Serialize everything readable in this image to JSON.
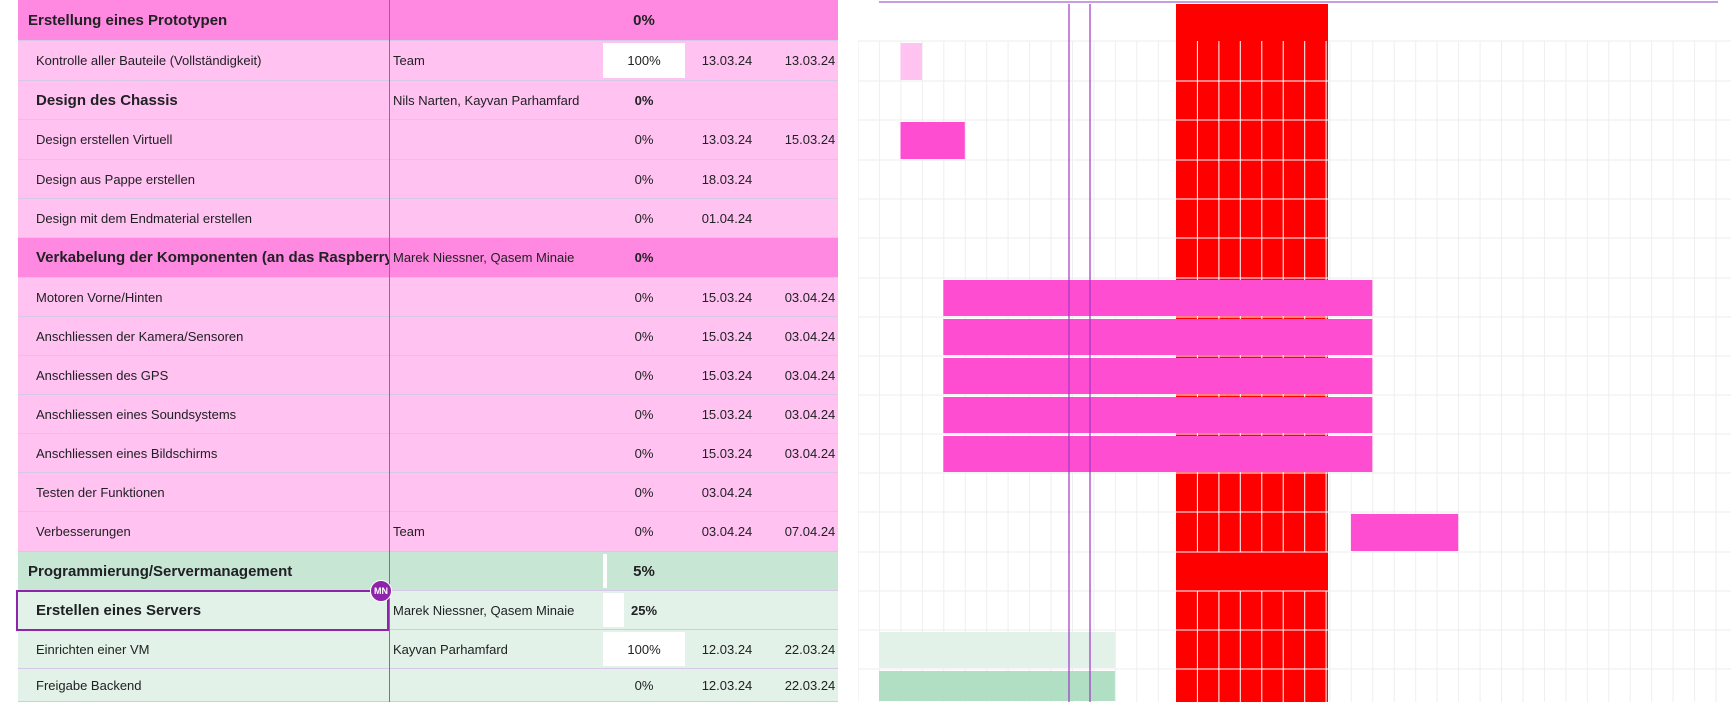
{
  "colors": {
    "section_pink": "#ff88e0",
    "row_pink": "#ffc2f1",
    "section_green": "#c8e6d4",
    "row_green": "#e2f2e8",
    "gantt_bar": "#ff4dd2",
    "gantt_bar_light": "#ffc2f1",
    "today_block": "#ff0000",
    "green_bar_light": "#e2f2e8",
    "green_bar": "#b0dfc4",
    "selection": "#8e24aa"
  },
  "rows": [
    {
      "type": "section",
      "group": "pink",
      "task": "Erstellung eines Prototypen",
      "team": "",
      "progress": "0%",
      "progress_value": 0,
      "start": "",
      "end": ""
    },
    {
      "type": "task",
      "group": "pink",
      "task": "Kontrolle aller Bauteile (Vollständigkeit)",
      "team": "Team",
      "progress": "100%",
      "progress_value": 1,
      "start": "13.03.24",
      "end": "13.03.24"
    },
    {
      "type": "subsection",
      "group": "pink",
      "task": "Design des Chassis",
      "team": "Nils Narten, Kayvan Parhamfard",
      "progress": "0%",
      "progress_value": 0,
      "start": "",
      "end": ""
    },
    {
      "type": "task",
      "group": "pink",
      "task": "Design erstellen Virtuell",
      "team": "",
      "progress": "0%",
      "progress_value": 0,
      "start": "13.03.24",
      "end": "15.03.24"
    },
    {
      "type": "task",
      "group": "pink",
      "task": "Design aus Pappe erstellen",
      "team": "",
      "progress": "0%",
      "progress_value": 0,
      "start": "18.03.24",
      "end": ""
    },
    {
      "type": "task",
      "group": "pink",
      "task": "Design mit dem Endmaterial erstellen",
      "team": "",
      "progress": "0%",
      "progress_value": 0,
      "start": "01.04.24",
      "end": ""
    },
    {
      "type": "subsection-strong",
      "group": "pink",
      "task": "Verkabelung der Komponenten (an das Raspberry",
      "team": "Marek Niessner, Qasem Minaie",
      "progress": "0%",
      "progress_value": 0,
      "start": "",
      "end": ""
    },
    {
      "type": "task",
      "group": "pink",
      "task": "Motoren Vorne/Hinten",
      "team": "",
      "progress": "0%",
      "progress_value": 0,
      "start": "15.03.24",
      "end": "03.04.24"
    },
    {
      "type": "task",
      "group": "pink",
      "task": "Anschliessen der Kamera/Sensoren",
      "team": "",
      "progress": "0%",
      "progress_value": 0,
      "start": "15.03.24",
      "end": "03.04.24"
    },
    {
      "type": "task",
      "group": "pink",
      "task": "Anschliessen des GPS",
      "team": "",
      "progress": "0%",
      "progress_value": 0,
      "start": "15.03.24",
      "end": "03.04.24"
    },
    {
      "type": "task",
      "group": "pink",
      "task": "Anschliessen eines Soundsystems",
      "team": "",
      "progress": "0%",
      "progress_value": 0,
      "start": "15.03.24",
      "end": "03.04.24"
    },
    {
      "type": "task",
      "group": "pink",
      "task": "Anschliessen eines Bildschirms",
      "team": "",
      "progress": "0%",
      "progress_value": 0,
      "start": "15.03.24",
      "end": "03.04.24"
    },
    {
      "type": "task",
      "group": "pink",
      "task": "Testen der Funktionen",
      "team": "",
      "progress": "0%",
      "progress_value": 0,
      "start": "03.04.24",
      "end": ""
    },
    {
      "type": "task",
      "group": "pink",
      "task": "Verbesserungen",
      "team": "Team",
      "progress": "0%",
      "progress_value": 0,
      "start": "03.04.24",
      "end": "07.04.24"
    },
    {
      "type": "section",
      "group": "green",
      "task": "Programmierung/Servermanagement",
      "team": "",
      "progress": "5%",
      "progress_value": 0.05,
      "start": "",
      "end": ""
    },
    {
      "type": "subsection",
      "group": "green",
      "task": "Erstellen eines Servers",
      "team": "Marek Niessner, Qasem Minaie",
      "progress": "25%",
      "progress_value": 0.25,
      "start": "",
      "end": ""
    },
    {
      "type": "task",
      "group": "green",
      "task": "Einrichten einer VM",
      "team": "Kayvan Parhamfard",
      "progress": "100%",
      "progress_value": 1,
      "start": "12.03.24",
      "end": "22.03.24"
    },
    {
      "type": "task",
      "group": "green",
      "task": "Freigabe Backend",
      "team": "",
      "progress": "0%",
      "progress_value": 0,
      "start": "12.03.24",
      "end": "22.03.24"
    }
  ],
  "collaborator_badge": {
    "initials": "MN"
  }
}
